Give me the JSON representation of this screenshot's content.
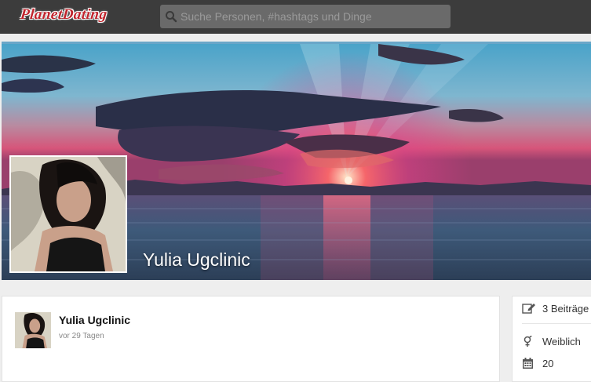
{
  "header": {
    "logo_text": "PlanetDating",
    "search_placeholder": "Suche Personen, #hashtags und Dinge"
  },
  "profile": {
    "name": "Yulia Ugclinic"
  },
  "post": {
    "author": "Yulia Ugclinic",
    "time": "vor 29 Tagen"
  },
  "info": {
    "posts": "3 Beiträge",
    "gender": "Weiblich",
    "age": "20"
  },
  "colors": {
    "topbar": "#3c3c3c",
    "logo": "#c0242c",
    "background": "#eeeeee"
  }
}
